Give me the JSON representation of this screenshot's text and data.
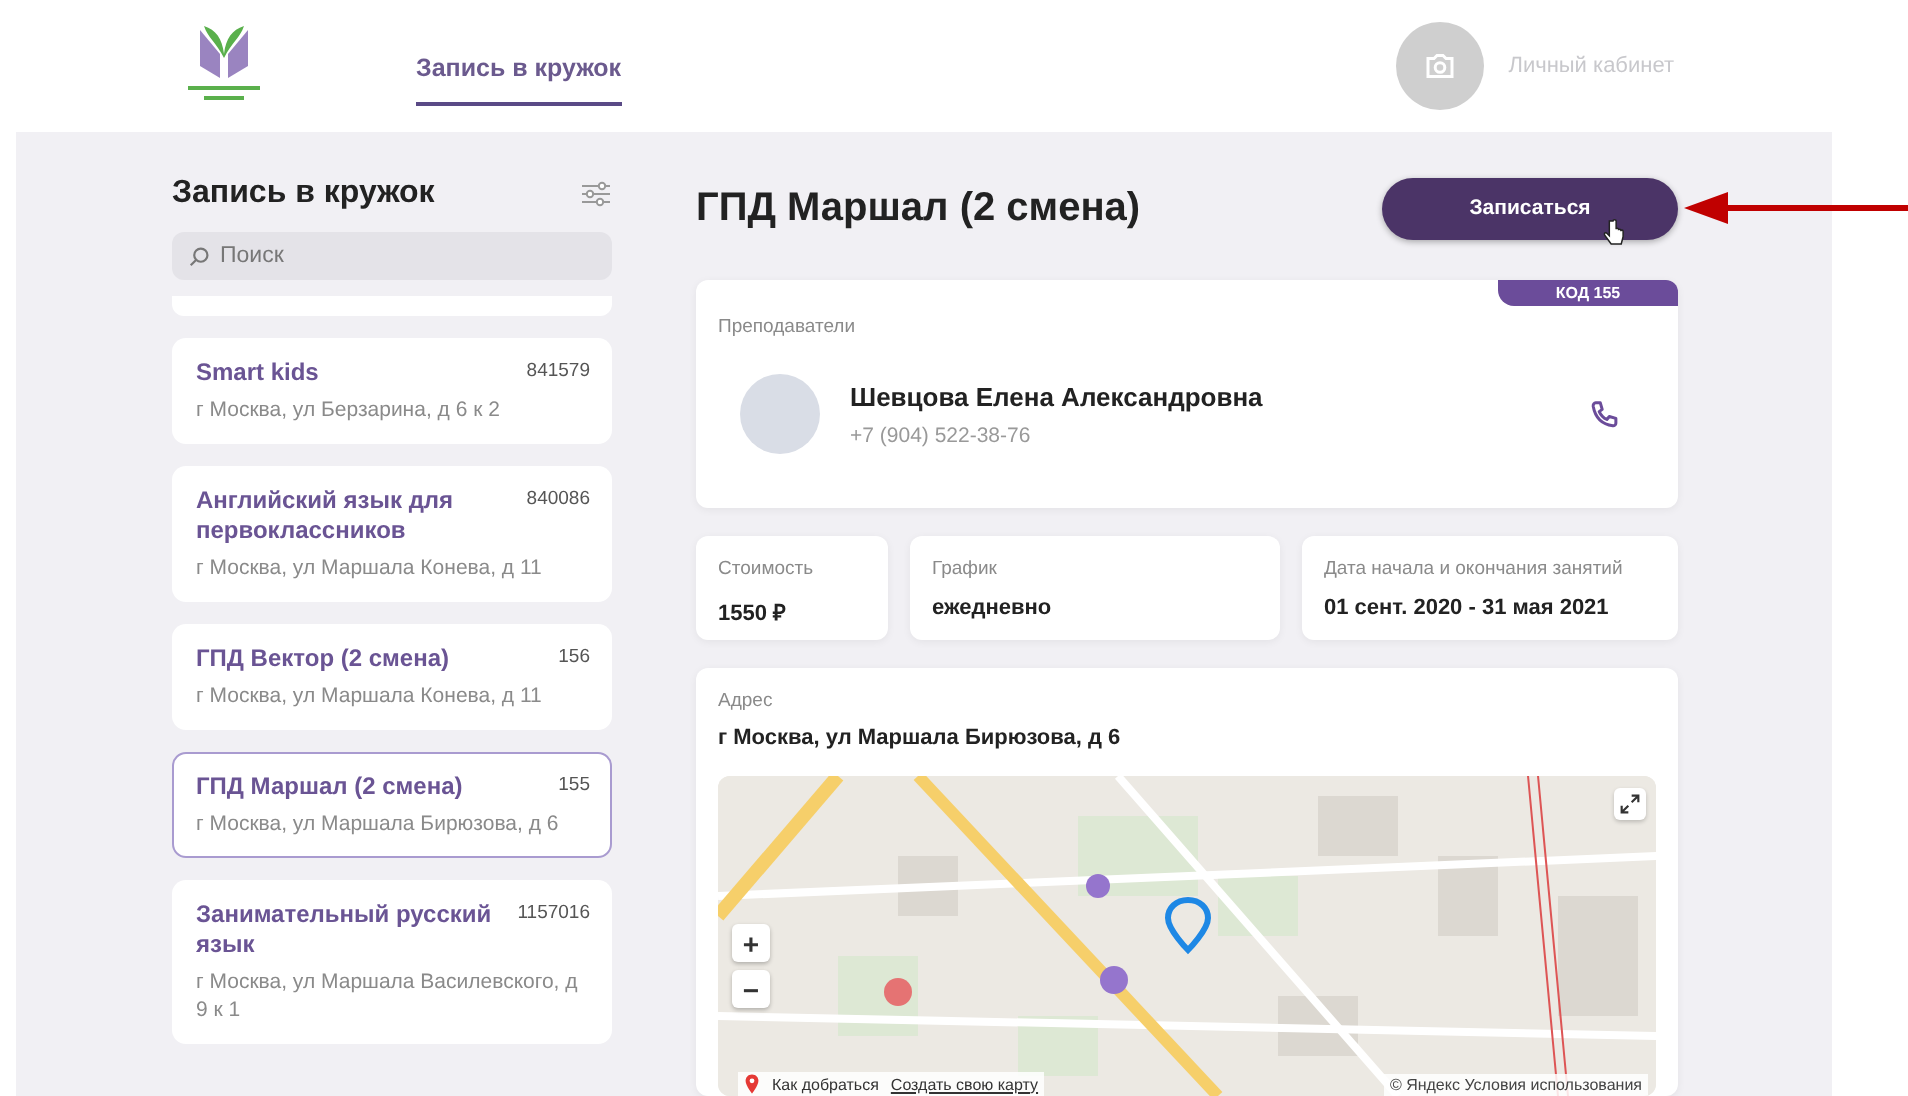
{
  "header": {
    "nav": [
      {
        "label": "Запись в кружок",
        "selected": true
      }
    ],
    "profile": {
      "label": "Личный кабинет"
    }
  },
  "sidebar": {
    "title": "Запись в кружок",
    "search": {
      "placeholder": "Поиск"
    },
    "clubs": [
      {
        "name": "Smart kids",
        "code": "841579",
        "address": "г Москва, ул Берзарина, д 6 к 2",
        "selected": false
      },
      {
        "name": "Английский язык для первоклассников",
        "code": "840086",
        "address": "г Москва, ул Маршала Конева, д 11",
        "selected": false
      },
      {
        "name": "ГПД Вектор (2 смена)",
        "code": "156",
        "address": "г Москва, ул Маршала Конева, д 11",
        "selected": false
      },
      {
        "name": "ГПД Маршал (2 смена)",
        "code": "155",
        "address": "г Москва, ул Маршала Бирюзова, д 6",
        "selected": true
      },
      {
        "name": "Занимательный русский язык",
        "code": "1157016",
        "address": "г Москва, ул Маршала Василевского, д 9 к 1",
        "selected": false
      }
    ]
  },
  "detail": {
    "title": "ГПД Маршал (2 смена)",
    "enroll_button": "Записаться",
    "code_badge": "КОД 155",
    "teachers": {
      "label": "Преподаватели",
      "items": [
        {
          "name": "Шевцова Елена Александровна",
          "phone": "+7 (904) 522-38-76"
        }
      ]
    },
    "facts": [
      {
        "label": "Стоимость",
        "value": "1550 ₽"
      },
      {
        "label": "График",
        "value": "ежедневно"
      },
      {
        "label": "Дата начала и окончания занятий",
        "value": "01 сент. 2020 - 31 мая 2021"
      }
    ],
    "address": {
      "label": "Адрес",
      "value": "г Москва, ул Маршала Бирюзова, д 6",
      "map": {
        "zoom_in": "+",
        "zoom_out": "−",
        "route_link": "Как добраться",
        "create_link": "Создать свою карту",
        "copyright": "© Яндекс Условия использования"
      }
    }
  }
}
